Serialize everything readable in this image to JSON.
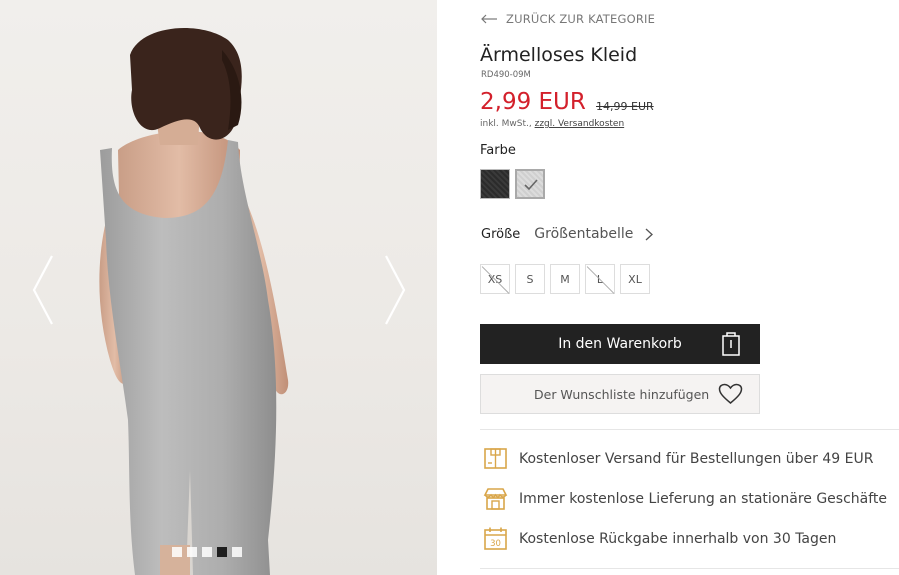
{
  "gallery": {
    "dots_count": 5,
    "active_dot": 3
  },
  "nav": {
    "back_label": "ZURÜCK ZUR KATEGORIE"
  },
  "product": {
    "title": "Ärmelloses Kleid",
    "sku": "RD490-09M",
    "price_current": "2,99 EUR",
    "price_old": "14,99 EUR",
    "vat_text": "inkl. MwSt., ",
    "shipping_link": "zzgl. Versandkosten"
  },
  "colors": {
    "label": "Farbe",
    "swatches": [
      {
        "name": "black",
        "hex": "#2f2f2f",
        "selected": false
      },
      {
        "name": "grey",
        "hex": "#d6d6d6",
        "selected": true
      }
    ]
  },
  "sizes": {
    "label": "Größe",
    "chart_link": "Größentabelle",
    "options": [
      {
        "label": "XS",
        "available": false
      },
      {
        "label": "S",
        "available": true
      },
      {
        "label": "M",
        "available": true
      },
      {
        "label": "L",
        "available": false
      },
      {
        "label": "XL",
        "available": true
      }
    ]
  },
  "actions": {
    "cart_label": "In den Warenkorb",
    "wishlist_label": "Der Wunschliste hinzufügen"
  },
  "benefits": [
    {
      "icon": "shipping-box-icon",
      "text": "Kostenloser Versand für Bestellungen über 49 EUR"
    },
    {
      "icon": "store-icon",
      "text": "Immer kostenlose Lieferung an stationäre Geschäfte"
    },
    {
      "icon": "calendar-30-icon",
      "text": "Kostenlose Rückgabe innerhalb von 30 Tagen"
    }
  ],
  "colors_theme": {
    "price_red": "#d3202b",
    "accent_gold": "#d9a64a",
    "button_dark": "#222222"
  }
}
